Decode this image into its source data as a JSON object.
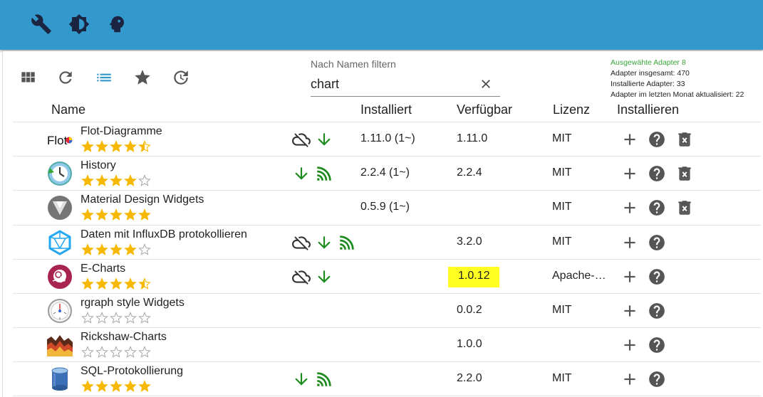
{
  "topbar": {
    "icons": [
      "wrench-icon",
      "brightness-icon",
      "expert-head-icon"
    ]
  },
  "toolbar": {
    "icons": [
      "grid-view-icon",
      "refresh-icon",
      "list-view-icon",
      "star-icon",
      "update-history-icon"
    ]
  },
  "filter": {
    "label": "Nach Namen filtern",
    "value": "chart"
  },
  "stats": {
    "selected": "Ausgewähte Adapter 8",
    "total": "Adapter insgesamt: 470",
    "installed": "Installierte Adapter: 33",
    "updated": "Adapter im letzten Monat aktualisiert: 22"
  },
  "columns": {
    "name": "Name",
    "installed": "Installiert",
    "available": "Verfügbar",
    "license": "Lizenz",
    "install": "Installieren"
  },
  "rows": [
    {
      "name": "Flot-Diagramme",
      "rating": 4.5,
      "installed": "1.11.0 (1~)",
      "available": "1.11.0",
      "license": "MIT",
      "icons": [
        "cloud-off-icon",
        "arrow-down-icon"
      ],
      "delete": true
    },
    {
      "name": "History",
      "rating": 4,
      "installed": "2.2.4 (1~)",
      "available": "2.2.4",
      "license": "MIT",
      "icons": [
        "arrow-down-icon",
        "signal-icon"
      ],
      "delete": true
    },
    {
      "name": "Material Design Widgets",
      "rating": 5,
      "installed": "0.5.9 (1~)",
      "available": "",
      "license": "MIT",
      "icons": [],
      "delete": true
    },
    {
      "name": "Daten mit InfluxDB protokollieren",
      "rating": 4,
      "installed": "",
      "available": "3.2.0",
      "license": "MIT",
      "icons": [
        "cloud-off-icon",
        "arrow-down-icon",
        "signal-icon"
      ],
      "delete": false
    },
    {
      "name": "E-Charts",
      "rating": 4.5,
      "installed": "",
      "available": "1.0.12",
      "license": "Apache-…",
      "icons": [
        "cloud-off-icon",
        "arrow-down-icon"
      ],
      "delete": false,
      "highlight": true
    },
    {
      "name": "rgraph style Widgets",
      "rating": 0,
      "installed": "",
      "available": "0.0.2",
      "license": "MIT",
      "icons": [],
      "delete": false
    },
    {
      "name": "Rickshaw-Charts",
      "rating": 0,
      "installed": "",
      "available": "1.0.0",
      "license": "",
      "icons": [],
      "delete": false
    },
    {
      "name": "SQL-Protokollierung",
      "rating": 5,
      "installed": "",
      "available": "2.2.0",
      "license": "MIT",
      "icons": [
        "arrow-down-icon",
        "signal-icon"
      ],
      "delete": false
    }
  ],
  "colors": {
    "topbar": "#3399cc",
    "star": "#f6b800",
    "green": "#1d8a1d",
    "highlight": "#ffff22",
    "icon": "#555555",
    "toolbar_active": "#3399cc"
  }
}
